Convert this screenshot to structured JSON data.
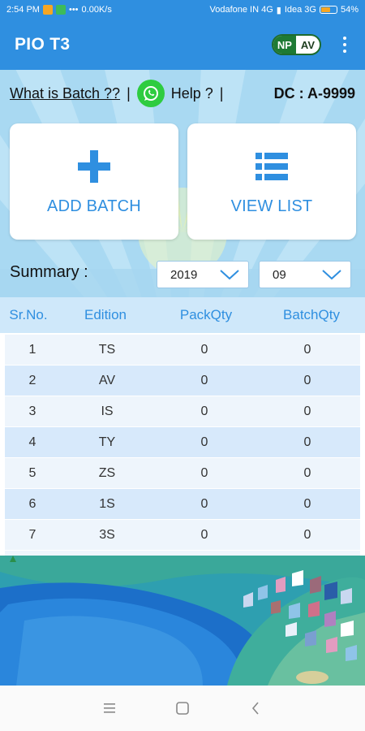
{
  "status_bar": {
    "time": "2:54 PM",
    "net_speed": "0.00K/s",
    "carrier1": "Vodafone IN 4G",
    "carrier2": "Idea 3G",
    "battery": "54%",
    "battery_level": 0.54
  },
  "app_bar": {
    "title": "PIO T3",
    "badge_np": "NP",
    "badge_av": "AV",
    "menu_icon": "more-vert-icon"
  },
  "info": {
    "what_is_batch": "What is Batch ??",
    "separator": "|",
    "help": "Help ?",
    "dc": "DC : A-9999",
    "whatsapp_icon": "whatsapp-icon"
  },
  "cards": {
    "add_batch": "ADD BATCH",
    "view_list": "VIEW LIST"
  },
  "summary": {
    "label": "Summary :",
    "year": "2019",
    "month": "09"
  },
  "table": {
    "headers": [
      "Sr.No.",
      "Edition",
      "PackQty",
      "BatchQty"
    ],
    "rows": [
      [
        "1",
        "TS",
        "0",
        "0"
      ],
      [
        "2",
        "AV",
        "0",
        "0"
      ],
      [
        "3",
        "IS",
        "0",
        "0"
      ],
      [
        "4",
        "TY",
        "0",
        "0"
      ],
      [
        "5",
        "ZS",
        "0",
        "0"
      ],
      [
        "6",
        "1S",
        "0",
        "0"
      ],
      [
        "7",
        "3S",
        "0",
        "0"
      ]
    ]
  },
  "colors": {
    "primary": "#2f8fe0",
    "header_bg": "#cfe8fa",
    "row_odd": "#eef5fc",
    "row_even": "#d7e9fb",
    "badge_green": "#1e7a34"
  }
}
